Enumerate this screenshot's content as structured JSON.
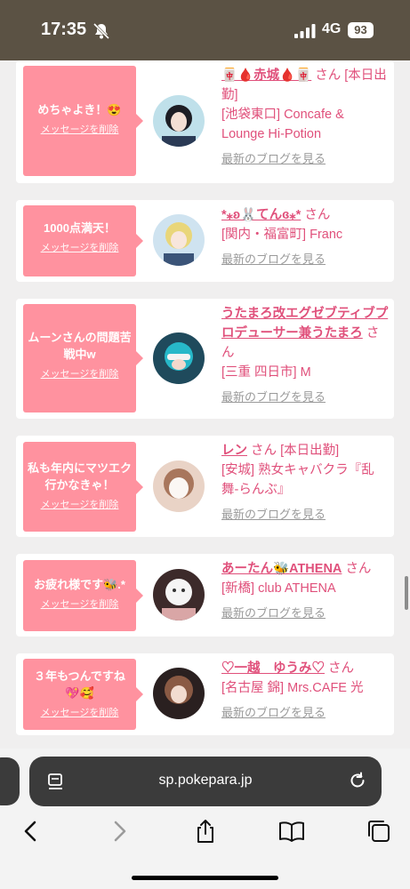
{
  "status_bar": {
    "time": "17:35",
    "network": "4G",
    "battery": "93"
  },
  "cards": [
    {
      "message": "めちゃよき！😍",
      "delete_label": "メッセージを削除",
      "name": "🀄🩸赤城🩸🀄",
      "san": "さん",
      "shop_info": "[本日出勤]\n[池袋東口] Concafe & Lounge Hi-Potion",
      "blog_label": "最新のブログを見る"
    },
    {
      "message": "1000点満天！",
      "delete_label": "メッセージを削除",
      "name": "*⁎ʚ🐰てんɞ⁎*",
      "san": "さん",
      "shop_info": "[関内・福富町] Franc",
      "blog_label": "最新のブログを見る"
    },
    {
      "message": "ムーンさんの問題苦戦中w",
      "delete_label": "メッセージを削除",
      "name": "うたまろ改エグゼブティブプロデューサー兼うたまろ",
      "san": "さん",
      "shop_info": "[三重 四日市] M",
      "blog_label": "最新のブログを見る"
    },
    {
      "message": "私も年内にマツエク行かなきゃ！",
      "delete_label": "メッセージを削除",
      "name": "レン",
      "san": "さん",
      "shop_info": "[本日出勤]\n[安城] 熟女キャバクラ『乱舞-らんぶ』",
      "blog_label": "最新のブログを見る"
    },
    {
      "message": "お疲れ様です🐝.*",
      "delete_label": "メッセージを削除",
      "name": "あーたん🐝ATHENA",
      "san": "さん",
      "shop_info": "[新橋] club ATHENA",
      "blog_label": "最新のブログを見る"
    },
    {
      "message": "３年もつんですね💖🥰",
      "delete_label": "メッセージを削除",
      "name": "♡一越　ゆうみ♡",
      "san": "さん",
      "shop_info": "[名古屋 錦] Mrs.CAFE 光",
      "blog_label": "最新のブログを見る"
    }
  ],
  "browser": {
    "url": "sp.pokepara.jp"
  },
  "colors": {
    "bubble": "#ff929f",
    "accent": "#e0507b",
    "status_bar": "#5b5244"
  }
}
